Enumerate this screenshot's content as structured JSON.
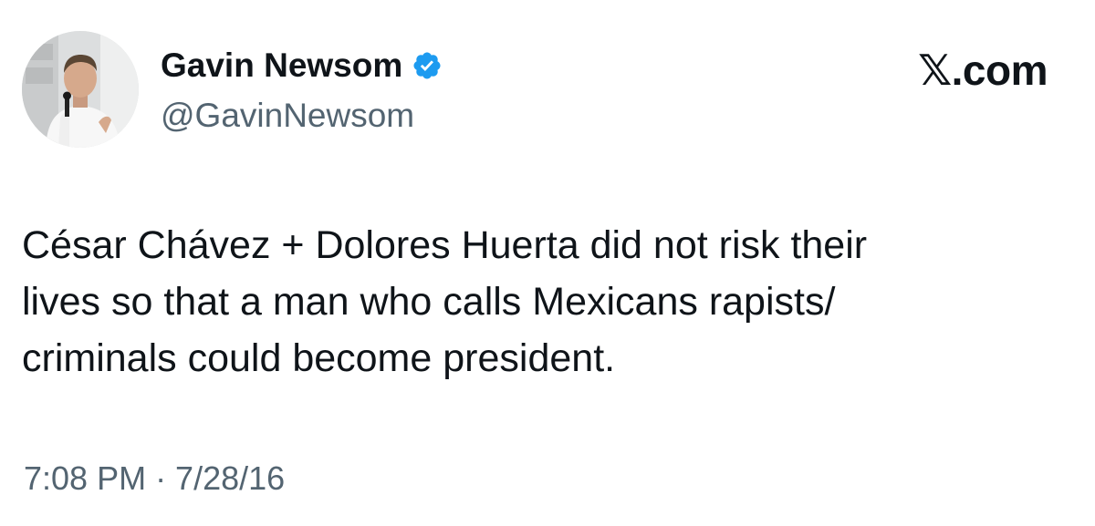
{
  "author": {
    "display_name": "Gavin Newsom",
    "handle": "@GavinNewsom",
    "verified": true,
    "verified_color": "#1d9bf0"
  },
  "brand": {
    "label": "𝕏.com"
  },
  "tweet": {
    "lines": [
      "César Chávez + Dolores Huerta did not risk their",
      "lives so that a man who calls Mexicans rapists/",
      "criminals could become president."
    ],
    "timestamp": "7:08 PM · 7/28/16"
  },
  "colors": {
    "text_primary": "#0f1419",
    "text_secondary": "#536471",
    "background": "#ffffff"
  }
}
